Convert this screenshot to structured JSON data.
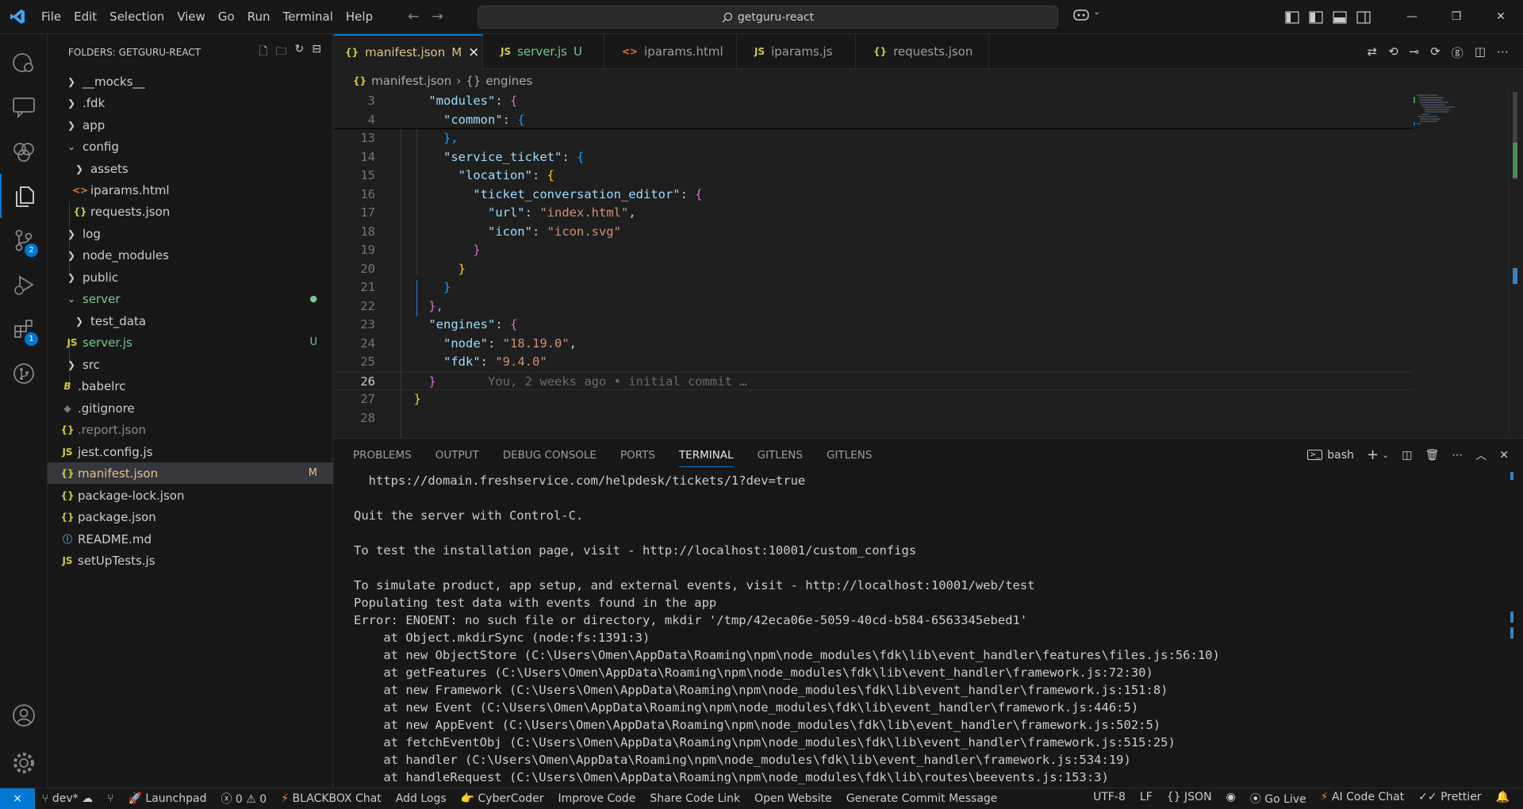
{
  "titlebar": {
    "menu": [
      "File",
      "Edit",
      "Selection",
      "View",
      "Go",
      "Run",
      "Terminal",
      "Help"
    ],
    "search_text": "getguru-react",
    "copilot_icon": "copilot-icon"
  },
  "activity": {
    "scm_badge": "2",
    "extensions_badge": "1"
  },
  "explorer": {
    "header": "FOLDERS: GETGURU-REACT",
    "items": [
      {
        "label": "__mocks__"
      },
      {
        "label": ".fdk"
      },
      {
        "label": "app"
      },
      {
        "label": "config"
      },
      {
        "label": "assets"
      },
      {
        "label": "iparams.html",
        "icon": "<>"
      },
      {
        "label": "requests.json",
        "icon": "{}"
      },
      {
        "label": "log"
      },
      {
        "label": "node_modules"
      },
      {
        "label": "public"
      },
      {
        "label": "server",
        "status": "●"
      },
      {
        "label": "test_data"
      },
      {
        "label": "server.js",
        "icon": "JS",
        "status": "U"
      },
      {
        "label": "src"
      },
      {
        "label": ".babelrc",
        "icon": "B"
      },
      {
        "label": ".gitignore",
        "icon": "◆"
      },
      {
        "label": ".report.json",
        "icon": "{}"
      },
      {
        "label": "jest.config.js",
        "icon": "JS"
      },
      {
        "label": "manifest.json",
        "icon": "{}",
        "status": "M"
      },
      {
        "label": "package-lock.json",
        "icon": "{}"
      },
      {
        "label": "package.json",
        "icon": "{}"
      },
      {
        "label": "README.md",
        "icon": "ⓘ"
      },
      {
        "label": "setUpTests.js",
        "icon": "JS"
      }
    ]
  },
  "tabs": [
    {
      "icon": "{}",
      "label": "manifest.json",
      "status": "M",
      "close": "×"
    },
    {
      "icon": "JS",
      "label": "server.js",
      "status": "U"
    },
    {
      "icon": "<>",
      "label": "iparams.html"
    },
    {
      "icon": "JS",
      "label": "iparams.js"
    },
    {
      "icon": "{}",
      "label": "requests.json"
    }
  ],
  "breadcrumb": {
    "file_icon": "{}",
    "file": "manifest.json",
    "sep": "›",
    "symbol_icon": "{}",
    "symbol": "engines"
  },
  "code": {
    "line_numbers": [
      "3",
      "4",
      "13",
      "14",
      "15",
      "16",
      "17",
      "18",
      "19",
      "20",
      "21",
      "22",
      "23",
      "24",
      "25",
      "26",
      "27",
      "28"
    ],
    "t": {
      "modules": "\"modules\"",
      "common": "\"common\"",
      "service_ticket": "\"service_ticket\"",
      "location": "\"location\"",
      "editor": "\"ticket_conversation_editor\"",
      "url": "\"url\"",
      "url_val": "\"index.html\"",
      "icon": "\"icon\"",
      "icon_val": "\"icon.svg\"",
      "engines": "\"engines\"",
      "node": "\"node\"",
      "node_val": "\"18.19.0\"",
      "fdk": "\"fdk\"",
      "fdk_val": "\"9.4.0\"",
      "blame": "You, 2 weeks ago • initial commit …",
      "colon": ": ",
      "comma": ",",
      "ob": "{",
      "cb": "}",
      "cbc": "},"
    }
  },
  "panel": {
    "tabs": [
      "PROBLEMS",
      "OUTPUT",
      "DEBUG CONSOLE",
      "PORTS",
      "TERMINAL",
      "GITLENS",
      "GITLENS"
    ],
    "shell": "bash",
    "terminal_lines": [
      "  https://domain.freshservice.com/helpdesk/tickets/1?dev=true",
      "",
      "Quit the server with Control-C.",
      "",
      "To test the installation page, visit - http://localhost:10001/custom_configs",
      "",
      "To simulate product, app setup, and external events, visit - http://localhost:10001/web/test",
      "Populating test data with events found in the app",
      "Error: ENOENT: no such file or directory, mkdir '/tmp/42eca06e-5059-40cd-b584-6563345ebed1'",
      "    at Object.mkdirSync (node:fs:1391:3)",
      "    at new ObjectStore (C:\\Users\\Omen\\AppData\\Roaming\\npm\\node_modules\\fdk\\lib\\event_handler\\features\\files.js:56:10)",
      "    at getFeatures (C:\\Users\\Omen\\AppData\\Roaming\\npm\\node_modules\\fdk\\lib\\event_handler\\framework.js:72:30)",
      "    at new Framework (C:\\Users\\Omen\\AppData\\Roaming\\npm\\node_modules\\fdk\\lib\\event_handler\\framework.js:151:8)",
      "    at new Event (C:\\Users\\Omen\\AppData\\Roaming\\npm\\node_modules\\fdk\\lib\\event_handler\\framework.js:446:5)",
      "    at new AppEvent (C:\\Users\\Omen\\AppData\\Roaming\\npm\\node_modules\\fdk\\lib\\event_handler\\framework.js:502:5)",
      "    at fetchEventObj (C:\\Users\\Omen\\AppData\\Roaming\\npm\\node_modules\\fdk\\lib\\event_handler\\framework.js:515:25)",
      "    at handler (C:\\Users\\Omen\\AppData\\Roaming\\npm\\node_modules\\fdk\\lib\\event_handler\\framework.js:534:19)",
      "    at handleRequest (C:\\Users\\Omen\\AppData\\Roaming\\npm\\node_modules\\fdk\\lib\\routes\\beevents.js:153:3)"
    ]
  },
  "statusbar": {
    "branch": "dev*",
    "errors": "0",
    "warnings": "0",
    "launchpad": "Launchpad",
    "blackbox": "BLACKBOX Chat",
    "add_logs": "Add Logs",
    "cybercoder": "CyberCoder",
    "improve_code": "Improve Code",
    "share_link": "Share Code Link",
    "open_website": "Open Website",
    "commit_msg": "Generate Commit Message",
    "encoding": "UTF-8",
    "eol": "LF",
    "lang_icon": "{}",
    "language": "JSON",
    "go_live": "Go Live",
    "ai_chat": "AI Code Chat",
    "prettier": "Prettier"
  }
}
